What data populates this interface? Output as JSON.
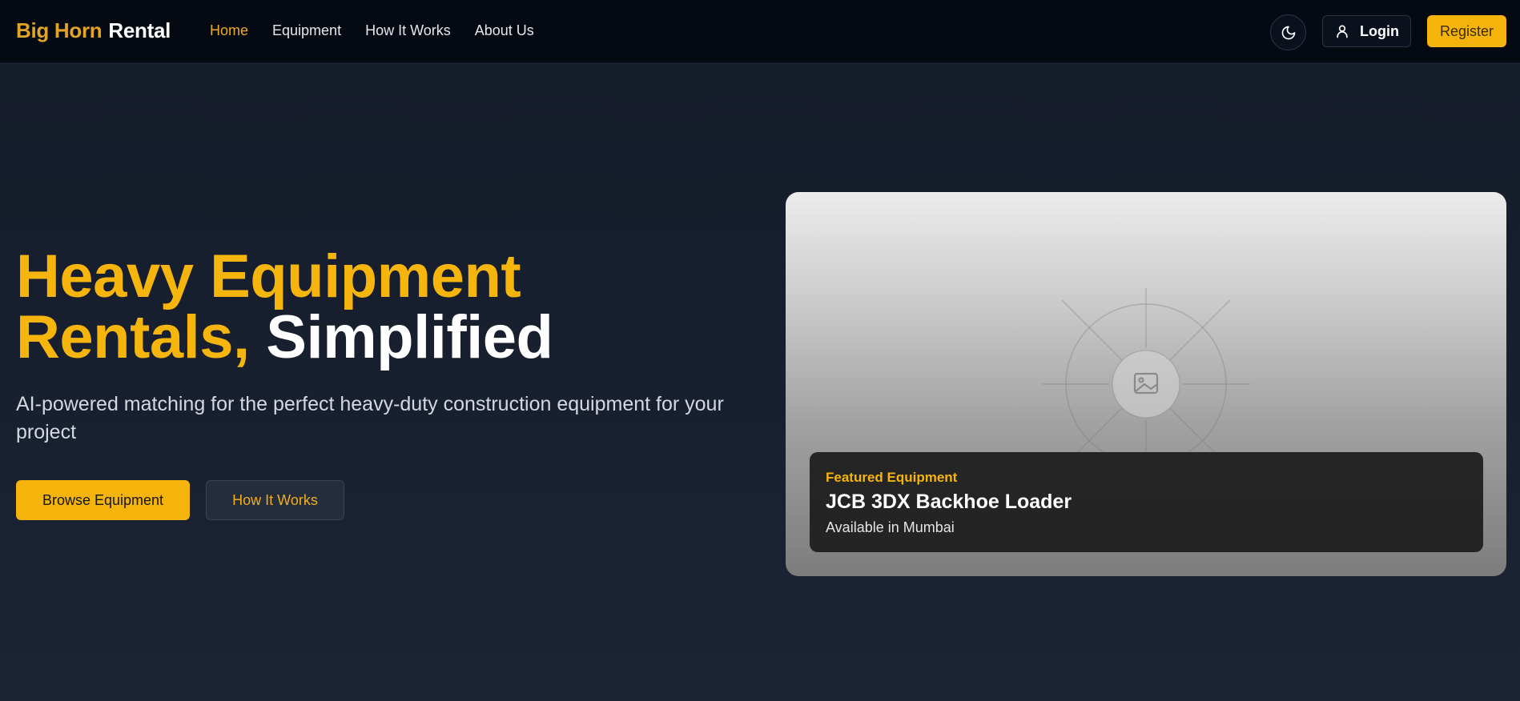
{
  "brand": {
    "part1": "Big Horn",
    "part2": "Rental"
  },
  "nav": {
    "items": [
      {
        "label": "Home",
        "active": true
      },
      {
        "label": "Equipment",
        "active": false
      },
      {
        "label": "How It Works",
        "active": false
      },
      {
        "label": "About Us",
        "active": false
      }
    ]
  },
  "header_actions": {
    "theme_icon": "moon-icon",
    "login_icon": "user-icon",
    "login_label": "Login",
    "register_label": "Register"
  },
  "hero": {
    "title_line1": "Heavy Equipment",
    "title_line2_accent": "Rentals,",
    "title_line2_plain": "Simplified",
    "subtitle": "AI-powered matching for the perfect heavy-duty construction equipment for your project",
    "primary_cta": "Browse Equipment",
    "secondary_cta": "How It Works"
  },
  "featured": {
    "placeholder_icon": "image-icon",
    "label": "Featured Equipment",
    "name": "JCB 3DX Backhoe Loader",
    "location": "Available in Mumbai"
  },
  "colors": {
    "accent": "#f5b40b",
    "nav_active": "#eea928",
    "header_bg": "#050912",
    "page_bg": "#192131"
  }
}
